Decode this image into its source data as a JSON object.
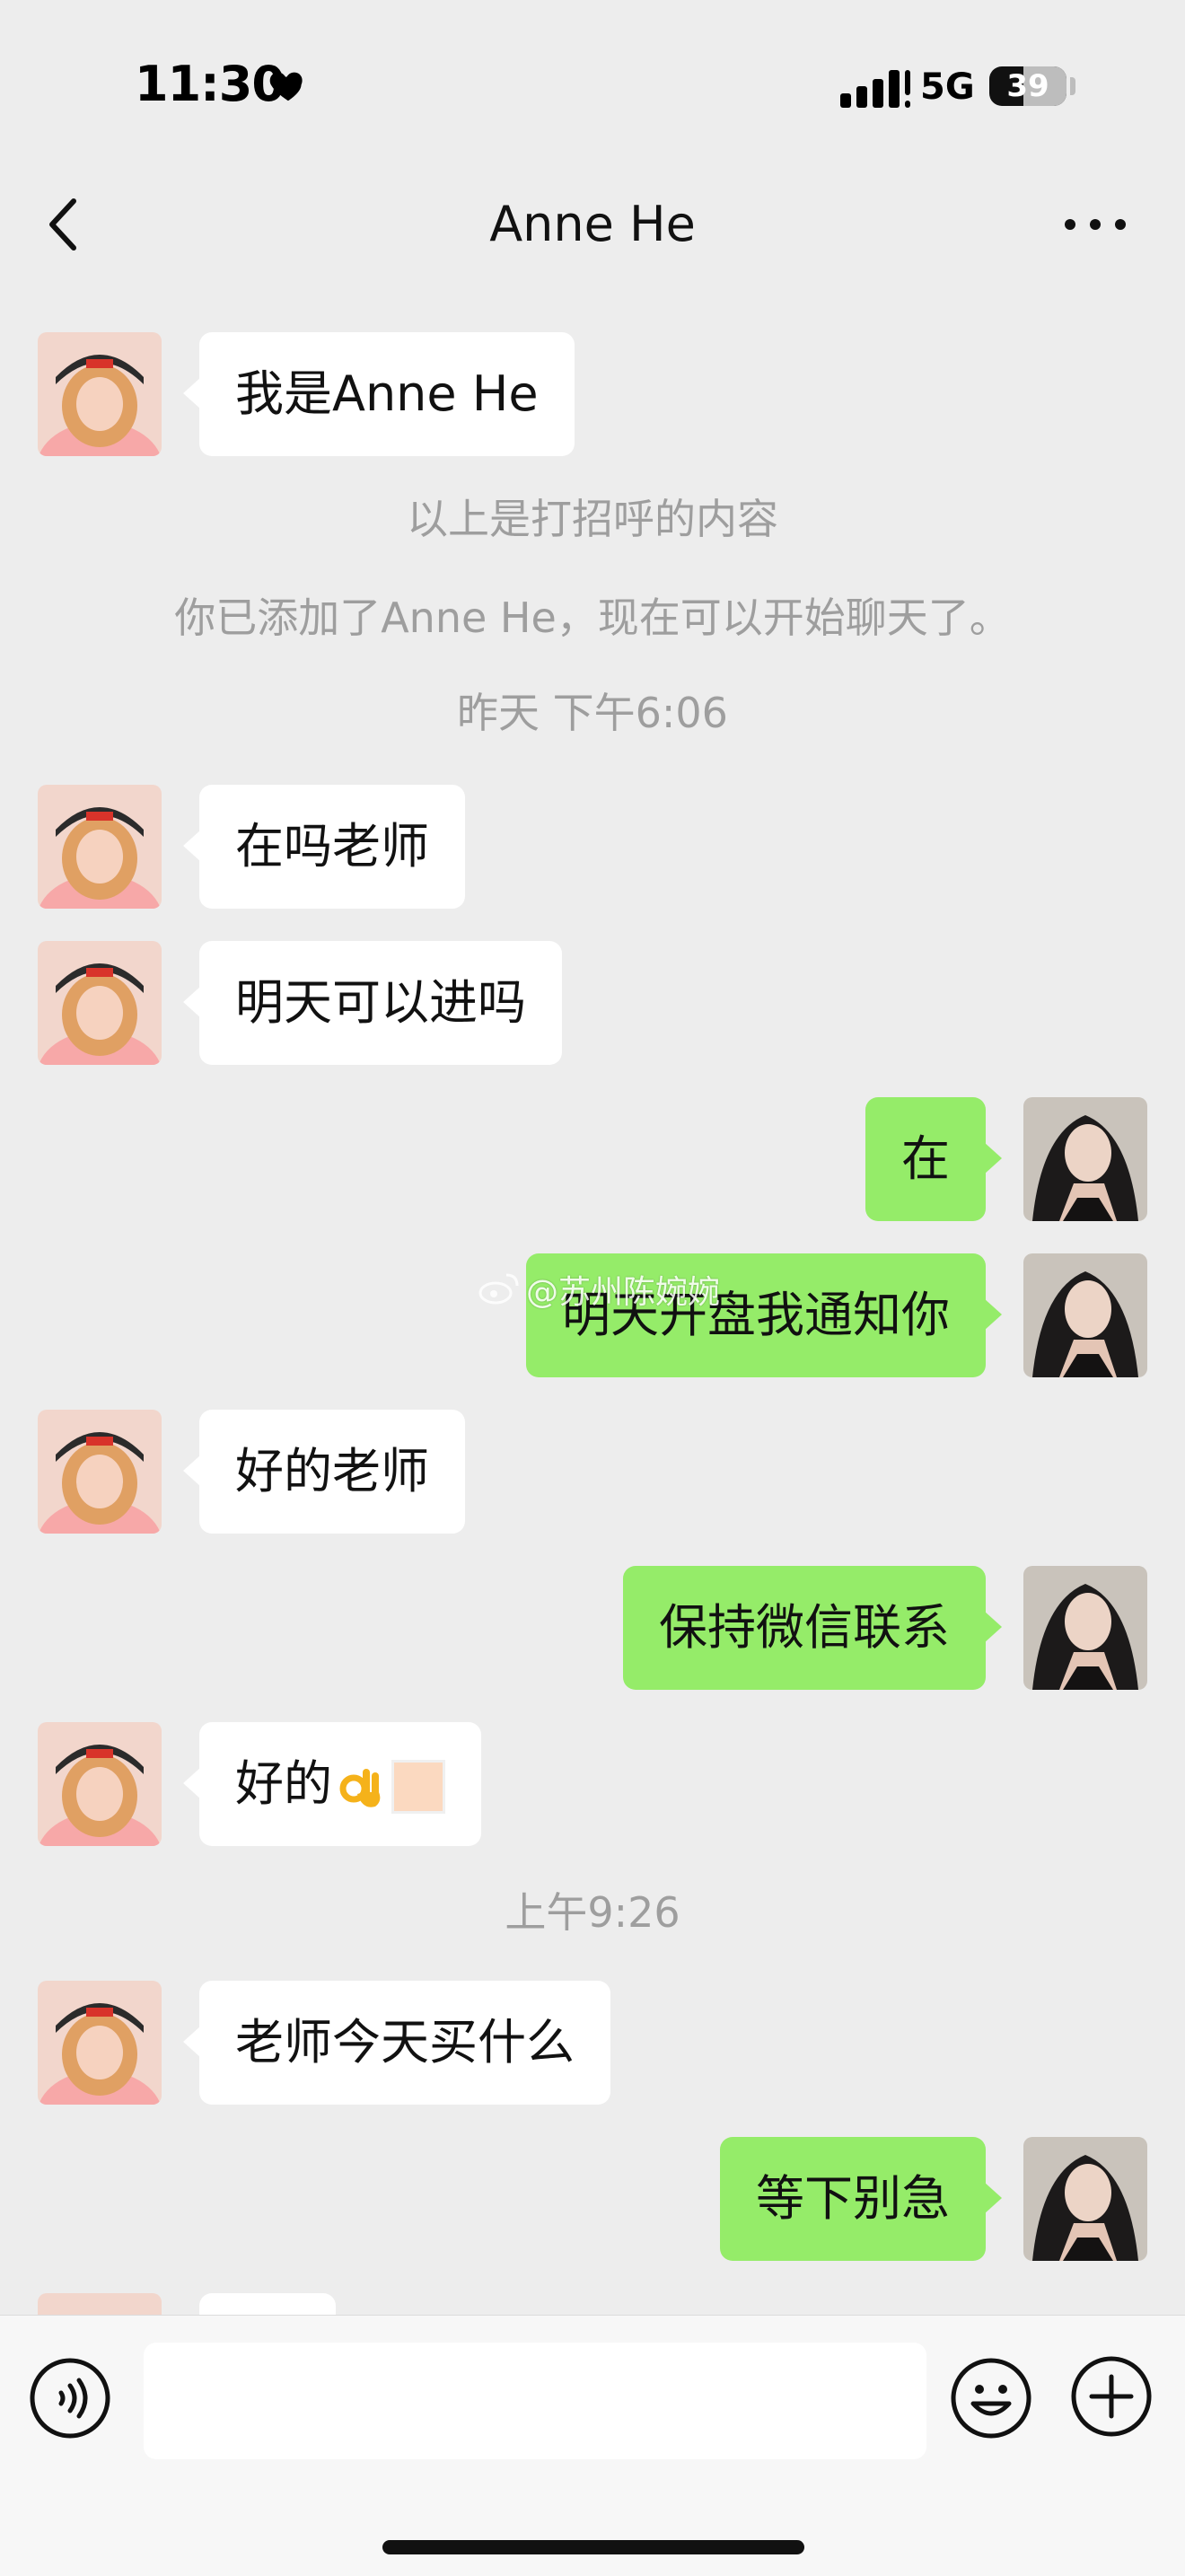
{
  "status_bar": {
    "time": "11:30",
    "network": "5G",
    "battery": "39"
  },
  "header": {
    "title": "Anne He"
  },
  "messages": [
    {
      "text": "我是Anne He"
    },
    {
      "text": "以上是打招呼的内容"
    },
    {
      "text": "你已添加了Anne He，现在可以开始聊天了。"
    },
    {
      "text": "昨天 下午6:06"
    },
    {
      "text": "在吗老师"
    },
    {
      "text": "明天可以进吗"
    },
    {
      "text": "在"
    },
    {
      "text": "明天开盘我通知你"
    },
    {
      "text": "好的老师"
    },
    {
      "text": "保持微信联系"
    },
    {
      "text": "好的"
    },
    {
      "text": "上午9:26"
    },
    {
      "text": "老师今天买什么"
    },
    {
      "text": "等下别急"
    }
  ],
  "watermark": {
    "text": "@苏州陈婉婉"
  },
  "input": {
    "value": ""
  },
  "colors": {
    "background": "#ededed",
    "outgoing_bubble": "#95ec69",
    "incoming_bubble": "#ffffff",
    "system_text": "#9e9e9e"
  },
  "icons": {
    "status": "heart-icon",
    "back": "chevron-left-icon",
    "more": "more-dots-icon",
    "voice": "voice-icon",
    "emoji": "emoji-icon",
    "plus": "plus-icon",
    "emoji_in_message": "ok-hand-icon"
  }
}
